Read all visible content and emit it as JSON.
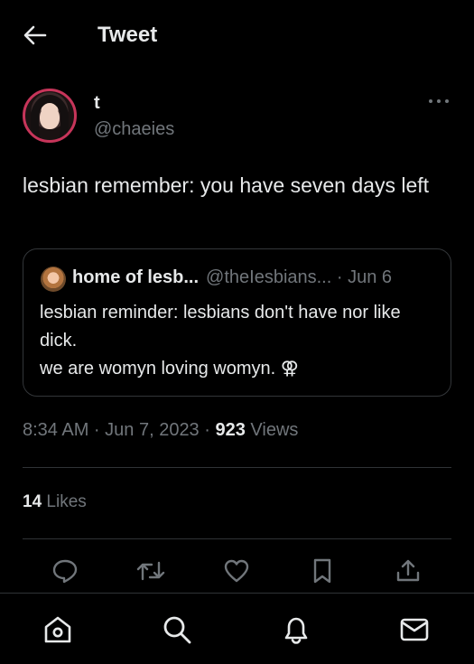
{
  "header": {
    "title": "Tweet",
    "back_icon": "arrow-left-icon"
  },
  "author": {
    "display_name": "t",
    "handle": "@chaeies",
    "avatar_ring_color": "#c7355a"
  },
  "tweet": {
    "text": "lesbian remember: you have seven days left"
  },
  "quoted": {
    "name": "home of lesb...",
    "handle_date": "@theIesbians... · Jun 6",
    "text_line1": "lesbian reminder: lesbians don't have nor like dick.",
    "text_line2": "we are womyn loving womyn. ⚢"
  },
  "meta": {
    "time_date": "8:34 AM · Jun 7, 2023 · ",
    "views_count": "923",
    "views_label": " Views"
  },
  "likes": {
    "count": "14",
    "label": " Likes"
  },
  "actions": [
    "reply-icon",
    "retweet-icon",
    "like-icon",
    "bookmark-icon",
    "share-icon"
  ],
  "bottom_nav": [
    "home-icon",
    "search-icon",
    "notifications-icon",
    "messages-icon"
  ],
  "colors": {
    "background": "#000000",
    "text": "#e7e9ea",
    "secondary": "#71767b",
    "border": "#2f3336"
  }
}
